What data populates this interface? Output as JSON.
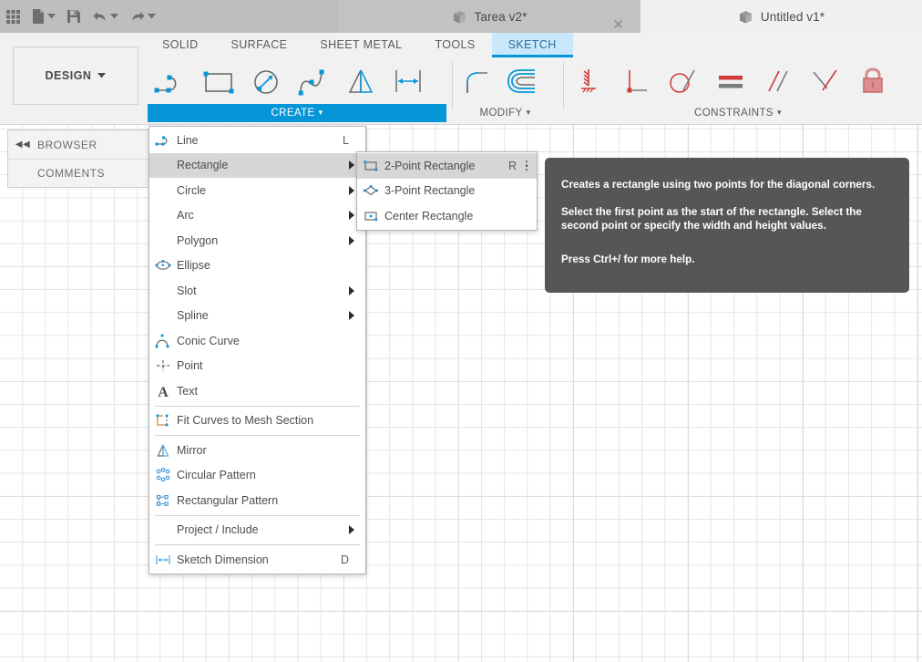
{
  "app": {
    "titlebar_buttons": [
      {
        "name": "grid-apps-icon",
        "label": "Show Data Panel"
      },
      {
        "name": "new-file-icon",
        "label": "File"
      },
      {
        "name": "save-icon",
        "label": "Save"
      },
      {
        "name": "undo-icon",
        "label": "Undo"
      },
      {
        "name": "redo-icon",
        "label": "Redo"
      }
    ],
    "tabs": [
      {
        "label": "Tarea v2*",
        "active": true,
        "closable": true
      },
      {
        "label": "Untitled v1*",
        "active": false,
        "closable": false
      }
    ]
  },
  "ribbon": {
    "workspace": "DESIGN",
    "tabs": [
      {
        "label": "SOLID",
        "active": false
      },
      {
        "label": "SURFACE",
        "active": false
      },
      {
        "label": "SHEET METAL",
        "active": false
      },
      {
        "label": "TOOLS",
        "active": false
      },
      {
        "label": "SKETCH",
        "active": true
      }
    ],
    "panels": [
      {
        "title": "CREATE",
        "active": true
      },
      {
        "title": "MODIFY",
        "active": false
      },
      {
        "title": "CONSTRAINTS",
        "active": false
      }
    ],
    "create_tools": [
      "line-icon",
      "rectangle-icon",
      "circle-icon",
      "spline-icon",
      "mirror-icon",
      "sketch-dimension-icon"
    ],
    "modify_tools": [
      "fillet-icon",
      "offset-icon"
    ],
    "constraint_tools": [
      "fix-unfix-icon",
      "perpendicular-icon",
      "tangent-icon",
      "equal-icon",
      "parallel-icon",
      "coincident-icon",
      "lock-icon"
    ]
  },
  "leftpanel": {
    "collapse_glyph": "◀◀",
    "rows": [
      {
        "label": "BROWSER",
        "has_arrows": true
      },
      {
        "label": "COMMENTS",
        "has_arrows": false
      }
    ]
  },
  "create_menu": {
    "items": [
      {
        "label": "Line",
        "icon": "line-icon",
        "shortcut": "L",
        "submenu": false,
        "selected": false
      },
      {
        "label": "Rectangle",
        "icon": "",
        "shortcut": "",
        "submenu": true,
        "selected": true
      },
      {
        "label": "Circle",
        "icon": "",
        "shortcut": "",
        "submenu": true,
        "selected": false
      },
      {
        "label": "Arc",
        "icon": "",
        "shortcut": "",
        "submenu": true,
        "selected": false
      },
      {
        "label": "Polygon",
        "icon": "",
        "shortcut": "",
        "submenu": true,
        "selected": false
      },
      {
        "label": "Ellipse",
        "icon": "ellipse-icon",
        "shortcut": "",
        "submenu": false,
        "selected": false
      },
      {
        "label": "Slot",
        "icon": "",
        "shortcut": "",
        "submenu": true,
        "selected": false
      },
      {
        "label": "Spline",
        "icon": "",
        "shortcut": "",
        "submenu": true,
        "selected": false
      },
      {
        "label": "Conic Curve",
        "icon": "conic-curve-icon",
        "shortcut": "",
        "submenu": false,
        "selected": false
      },
      {
        "label": "Point",
        "icon": "point-icon",
        "shortcut": "",
        "submenu": false,
        "selected": false
      },
      {
        "label": "Text",
        "icon": "text-icon",
        "shortcut": "",
        "submenu": false,
        "selected": false
      },
      {
        "label": "Fit Curves to Mesh Section",
        "icon": "fit-curves-icon",
        "shortcut": "",
        "submenu": false,
        "selected": false
      },
      {
        "label": "Mirror",
        "icon": "mirror-icon",
        "shortcut": "",
        "submenu": false,
        "selected": false
      },
      {
        "label": "Circular Pattern",
        "icon": "circular-pattern-icon",
        "shortcut": "",
        "submenu": false,
        "selected": false
      },
      {
        "label": "Rectangular Pattern",
        "icon": "rectangular-pattern-icon",
        "shortcut": "",
        "submenu": false,
        "selected": false
      },
      {
        "label": "Project / Include",
        "icon": "",
        "shortcut": "",
        "submenu": true,
        "selected": false
      },
      {
        "label": "Sketch Dimension",
        "icon": "sketch-dimension-icon",
        "shortcut": "D",
        "submenu": false,
        "selected": false
      }
    ]
  },
  "rectangle_submenu": {
    "items": [
      {
        "label": "2-Point Rectangle",
        "icon": "two-point-rectangle-icon",
        "shortcut": "R",
        "selected": true,
        "overflow": true
      },
      {
        "label": "3-Point Rectangle",
        "icon": "three-point-rectangle-icon",
        "shortcut": "",
        "selected": false,
        "overflow": false
      },
      {
        "label": "Center Rectangle",
        "icon": "center-rectangle-icon",
        "shortcut": "",
        "selected": false,
        "overflow": false
      }
    ]
  },
  "tooltip": {
    "paragraphs": [
      "Creates a rectangle using two points for the diagonal corners.",
      "Select the first point as the start of the rectangle. Select the second point or specify the width and height values.",
      "Press Ctrl+/ for more help."
    ]
  },
  "colors": {
    "accent": "#0696d7",
    "tab_active_bg": "#c9e8fb",
    "tooltip_bg": "#565656",
    "menu_selected": "#d6d6d6",
    "constraint_red": "#d25c5c"
  }
}
